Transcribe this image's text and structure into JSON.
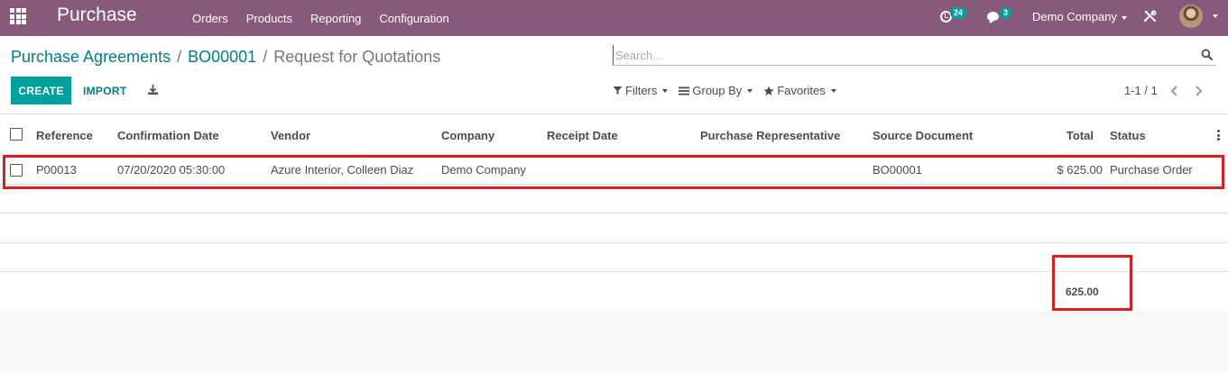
{
  "navbar": {
    "app_name": "Purchase",
    "menu": [
      "Orders",
      "Products",
      "Reporting",
      "Configuration"
    ],
    "activity_count": "24",
    "message_count": "3",
    "company": "Demo Company"
  },
  "breadcrumb": {
    "items": [
      "Purchase Agreements",
      "BO00001"
    ],
    "current": "Request for Quotations"
  },
  "search": {
    "placeholder": "Search...",
    "value": ""
  },
  "toolbar": {
    "create_label": "CREATE",
    "import_label": "IMPORT"
  },
  "search_options": {
    "filters_label": "Filters",
    "group_by_label": "Group By",
    "favorites_label": "Favorites"
  },
  "pager": {
    "value": "1-1 / 1"
  },
  "table": {
    "columns": [
      "Reference",
      "Confirmation Date",
      "Vendor",
      "Company",
      "Receipt Date",
      "Purchase Representative",
      "Source Document",
      "Total",
      "Status"
    ],
    "rows": [
      {
        "reference": "P00013",
        "confirmation_date": "07/20/2020 05:30:00",
        "vendor": "Azure Interior, Colleen Diaz",
        "company": "Demo Company",
        "receipt_date": "",
        "representative": "",
        "source_document": "BO00001",
        "total": "$ 625.00",
        "status": "Purchase Order"
      }
    ],
    "footer_total": "625.00"
  },
  "colors": {
    "navbar": "#875a7b",
    "primary": "#00a09d",
    "link": "#017e84",
    "annotation": "#e11b22"
  },
  "icons": [
    "apps-grid-icon",
    "clock-icon",
    "chat-icon",
    "caret-down-icon",
    "debug-tools-icon",
    "search-icon",
    "download-icon",
    "filter-icon",
    "group-by-icon",
    "star-icon",
    "chevron-left-icon",
    "chevron-right-icon",
    "kebab-icon"
  ]
}
